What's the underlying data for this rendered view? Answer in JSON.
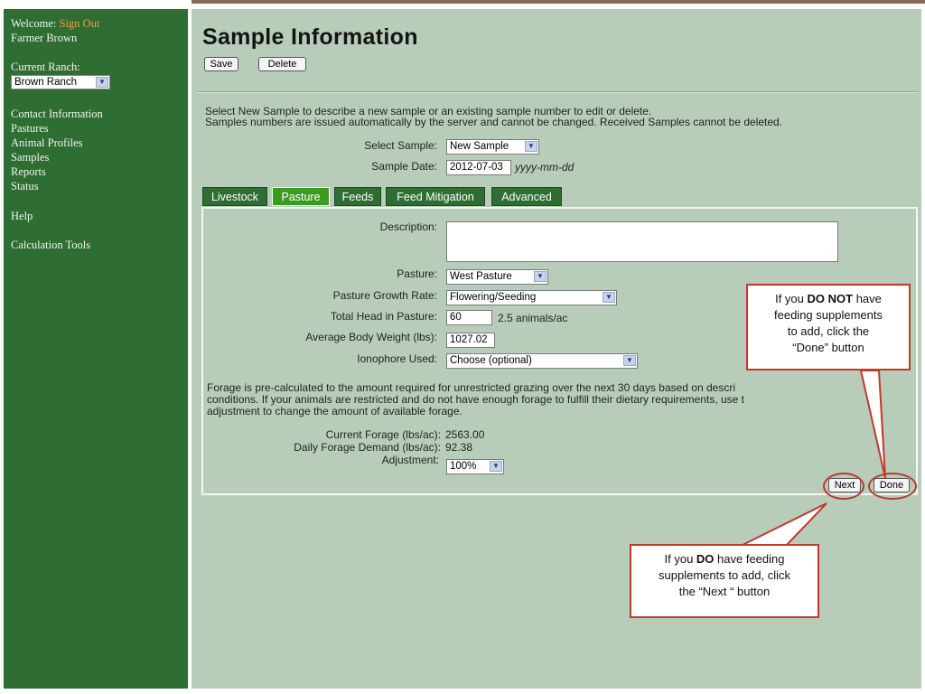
{
  "sidebar": {
    "welcome_label": "Welcome:",
    "sign_out": "Sign Out",
    "user_name": "Farmer Brown",
    "current_ranch_label": "Current Ranch:",
    "ranch_value": "Brown Ranch",
    "nav": [
      "Contact Information",
      "Pastures",
      "Animal Profiles",
      "Samples",
      "Reports",
      "Status"
    ],
    "help": "Help",
    "calc_tools": "Calculation Tools"
  },
  "main": {
    "title": "Sample Information",
    "save_label": "Save",
    "delete_label": "Delete",
    "intro_line1": "Select New Sample to describe a new sample or an existing sample number to edit or delete.",
    "intro_line2": "Samples numbers are issued automatically by the server and cannot be changed. Received Samples cannot be deleted.",
    "select_sample_label": "Select Sample:",
    "select_sample_value": "New Sample",
    "sample_date_label": "Sample Date:",
    "sample_date_value": "2012-07-03",
    "sample_date_hint": "yyyy-mm-dd",
    "tabs": [
      "Livestock",
      "Pasture",
      "Feeds",
      "Feed Mitigation",
      "Advanced"
    ],
    "active_tab": "Pasture"
  },
  "pasture": {
    "description_label": "Description:",
    "description_value": "",
    "pasture_label": "Pasture:",
    "pasture_value": "West Pasture",
    "growth_label": "Pasture Growth Rate:",
    "growth_value": "Flowering/Seeding",
    "head_label": "Total Head in Pasture:",
    "head_value": "60",
    "density_text": "2.5 animals/ac",
    "weight_label": "Average Body Weight (lbs):",
    "weight_value": "1027.02",
    "ionophore_label": "Ionophore Used:",
    "ionophore_value": "Choose (optional)",
    "forage_line1": "Forage is pre-calculated to the amount required for unrestricted grazing over the next 30 days based on descri",
    "forage_line2": "conditions. If your animals are restricted and do not have enough forage to fulfill their dietary requirements, use t",
    "forage_line3": "adjustment to change the amount of available forage.",
    "current_forage_label": "Current Forage (lbs/ac):",
    "current_forage_value": "2563.00",
    "daily_demand_label": "Daily Forage Demand (lbs/ac):",
    "daily_demand_value": "92.38",
    "adjustment_label": "Adjustment:",
    "adjustment_value": "100%",
    "next_label": "Next",
    "done_label": "Done"
  },
  "callouts": {
    "done_note": {
      "l1_pre": "If you ",
      "l1_bold": "DO NOT",
      "l1_post": " have",
      "l2": "feeding supplements",
      "l3": "to add, click the",
      "l4": "“Done” button"
    },
    "next_note": {
      "l1_pre": "If you ",
      "l1_bold": "DO",
      "l1_post": " have feeding",
      "l2": "supplements to add, click",
      "l3": "the “Next “ button"
    }
  },
  "colors": {
    "sidebar_green": "#2f6e33",
    "main_background": "#b8cdb9",
    "active_tab": "#3a9a22",
    "link_orange": "#ff9a3c",
    "callout_red": "#c0392b"
  }
}
